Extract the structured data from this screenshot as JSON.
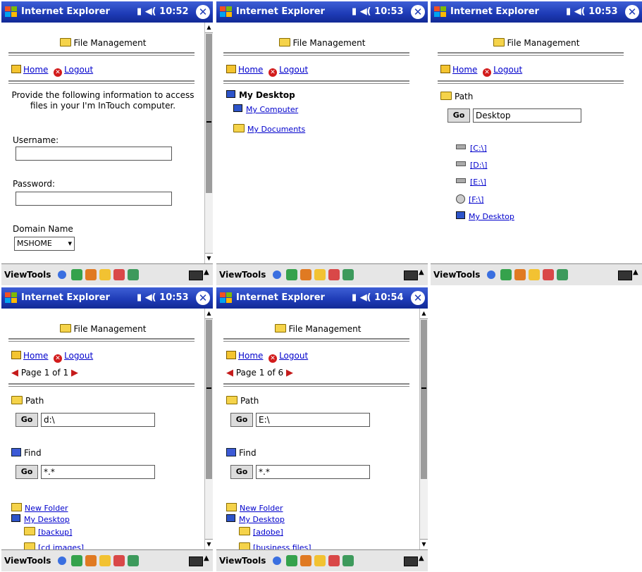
{
  "common": {
    "app_title": "Internet Explorer",
    "menu_view": "View",
    "menu_tools": "Tools",
    "section_title": "File Management",
    "home_label": "Home",
    "logout_label": "Logout",
    "path_label": "Path",
    "find_label": "Find",
    "go_label": "Go"
  },
  "screens": [
    {
      "time": "10:52",
      "intro_text": "Provide the following information to access files in your I'm InTouch computer.",
      "username_label": "Username:",
      "username_value": "",
      "password_label": "Password:",
      "password_value": "",
      "domain_label": "Domain Name",
      "domain_value": "MSHOME"
    },
    {
      "time": "10:53",
      "desktop_title": "My Desktop",
      "links": [
        "My Computer",
        "My Documents"
      ]
    },
    {
      "time": "10:53",
      "path_value": "Desktop",
      "drives": [
        "[C:\\]",
        "[D:\\]",
        "[E:\\]",
        "[F:\\]"
      ],
      "desktop_link": "My Desktop"
    },
    {
      "time": "10:53",
      "page_text": "Page 1 of 1",
      "path_value": "d:\\",
      "find_value": "*.*",
      "new_folder": "New Folder",
      "desktop_link": "My Desktop",
      "folders": [
        "[backup]",
        "[cd images]"
      ]
    },
    {
      "time": "10:54",
      "page_text": "Page 1 of 6",
      "path_value": "E:\\",
      "find_value": "*.*",
      "new_folder": "New Folder",
      "desktop_link": "My Desktop",
      "folders": [
        "[adobe]",
        "[business files]"
      ]
    }
  ]
}
